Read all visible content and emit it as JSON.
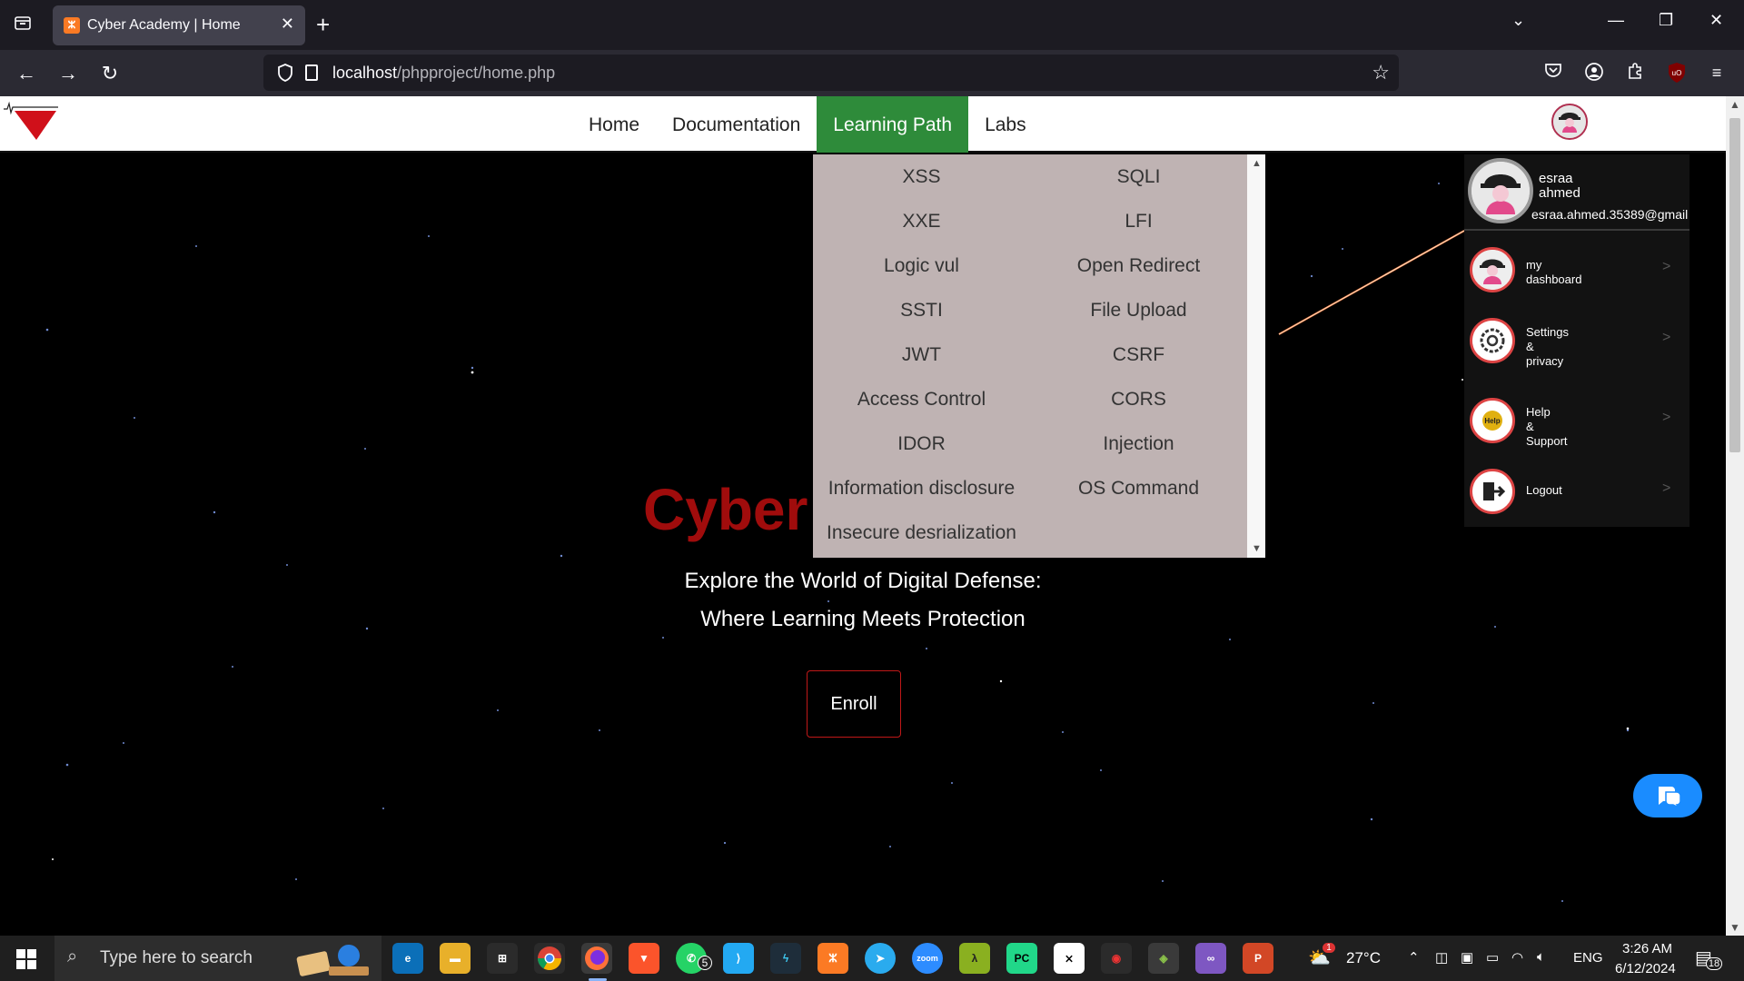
{
  "browser": {
    "tab_title": "Cyber Academy | Home",
    "url_host": "localhost",
    "url_path": "/phpproject/home.php",
    "tab_close": "✕",
    "new_tab": "+"
  },
  "site": {
    "menu": [
      {
        "label": "Home",
        "active": false
      },
      {
        "label": "Documentation",
        "active": false
      },
      {
        "label": "Learning Path",
        "active": true
      },
      {
        "label": "Labs",
        "active": false
      }
    ],
    "learning_path_items": [
      "XSS",
      "SQLI",
      "XXE",
      "LFI",
      "Logic vul",
      "Open Redirect",
      "SSTI",
      "File Upload",
      "JWT",
      "CSRF",
      "Access Control",
      "CORS",
      "IDOR",
      "Injection",
      "Information disclosure",
      "OS Command",
      "Insecure desrialization"
    ],
    "hero": {
      "title": "Cyber",
      "line1": "Explore the World of Digital Defense:",
      "line2": "Where Learning Meets Protection",
      "enroll": "Enroll"
    },
    "profile": {
      "first_name": "esraa",
      "last_name": "ahmed",
      "email": "esraa.ahmed.35389@gmail",
      "items": [
        {
          "line1": "my",
          "line2": "dashboard",
          "line3": ""
        },
        {
          "line1": "Settings",
          "line2": "&",
          "line3": "privacy"
        },
        {
          "line1": "Help",
          "line2": "&",
          "line3": "Support"
        },
        {
          "line1": "Logout",
          "line2": "",
          "line3": ""
        }
      ],
      "arrow": ">",
      "help_badge": "Help"
    },
    "accent_colors": {
      "active_menu": "#2e8b3a",
      "title_red": "#a00c0c",
      "dropdown_bg": "#bfb3b3",
      "chat_blue": "#1a8cff"
    }
  },
  "taskbar": {
    "search_placeholder": "Type here to search",
    "whatsapp_badge": "5",
    "weather": "27°C",
    "weather_badge": "1",
    "language": "ENG",
    "time": "3:26 AM",
    "date": "6/12/2024",
    "notification_count": "18",
    "zoom_label": "zoom",
    "pycharm_label": "PC"
  }
}
